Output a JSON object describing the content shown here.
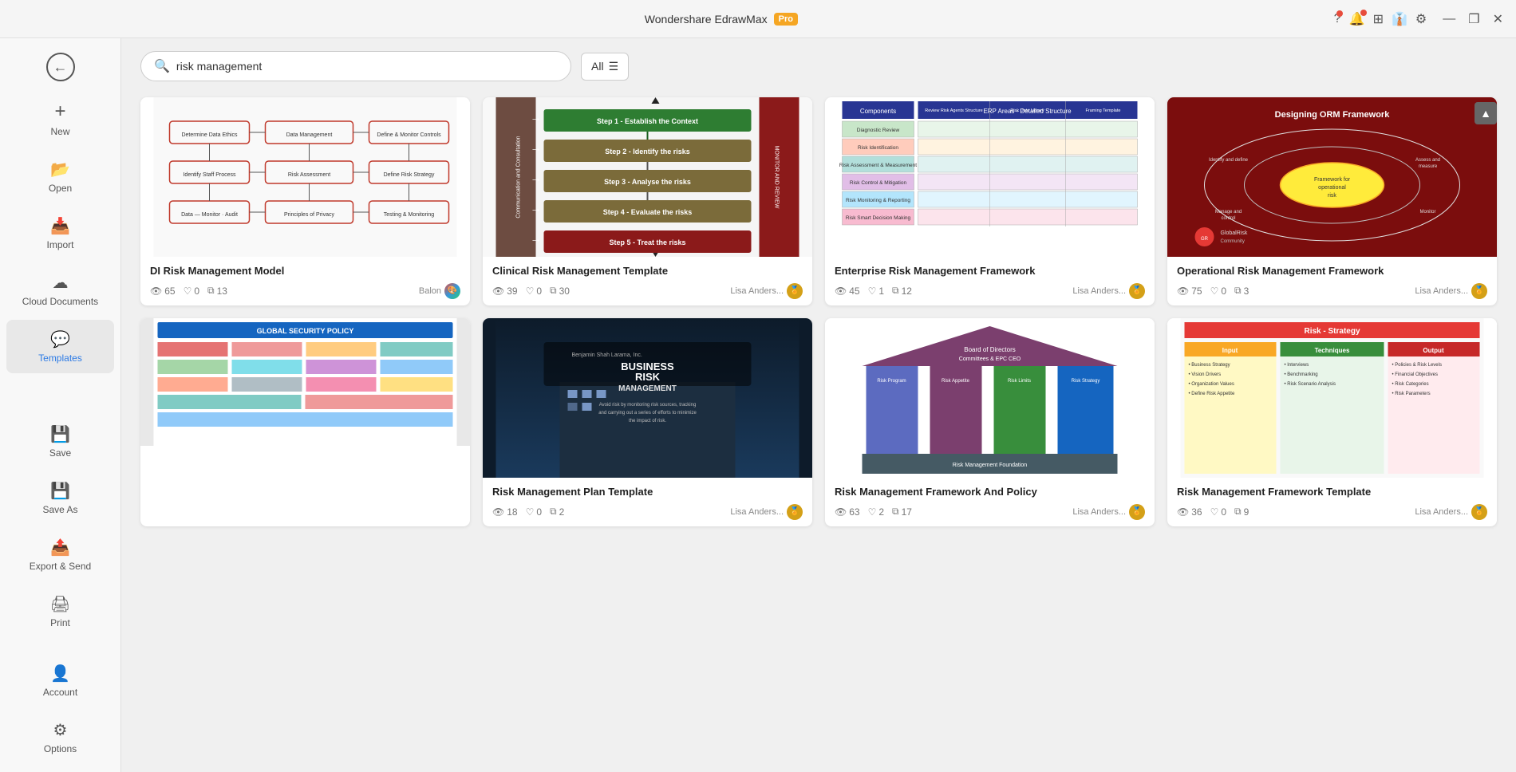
{
  "app": {
    "title": "Wondershare EdrawMax",
    "badge": "Pro"
  },
  "titlebar": {
    "minimize": "—",
    "restore": "❐",
    "close": "✕"
  },
  "toolbar": {
    "icons": [
      "?",
      "🔔",
      "⊞",
      "👔",
      "⚙"
    ]
  },
  "sidebar": {
    "back_label": "←",
    "items": [
      {
        "id": "new",
        "icon": "➕",
        "label": "New"
      },
      {
        "id": "open",
        "icon": "📂",
        "label": "Open"
      },
      {
        "id": "import",
        "icon": "📥",
        "label": "Import"
      },
      {
        "id": "cloud",
        "icon": "☁",
        "label": "Cloud Documents"
      },
      {
        "id": "templates",
        "icon": "💬",
        "label": "Templates",
        "active": true
      },
      {
        "id": "save",
        "icon": "💾",
        "label": "Save"
      },
      {
        "id": "saveas",
        "icon": "💾",
        "label": "Save As"
      },
      {
        "id": "export",
        "icon": "📤",
        "label": "Export & Send"
      },
      {
        "id": "print",
        "icon": "🖨",
        "label": "Print"
      }
    ],
    "bottom": [
      {
        "id": "account",
        "icon": "👤",
        "label": "Account"
      },
      {
        "id": "options",
        "icon": "⚙",
        "label": "Options"
      }
    ]
  },
  "search": {
    "placeholder": "risk management",
    "value": "risk management",
    "filter_label": "All"
  },
  "templates": [
    {
      "id": "di-risk",
      "title": "DI Risk Management Model",
      "views": 65,
      "likes": 0,
      "copies": 13,
      "author": "Balon",
      "author_type": "colorful"
    },
    {
      "id": "clinical-risk",
      "title": "Clinical Risk Management Template",
      "views": 39,
      "likes": 0,
      "copies": 30,
      "author": "Lisa Anders...",
      "author_type": "gold"
    },
    {
      "id": "enterprise-risk",
      "title": "Enterprise Risk Management Framework",
      "views": 45,
      "likes": 1,
      "copies": 12,
      "author": "Lisa Anders...",
      "author_type": "gold"
    },
    {
      "id": "orm-framework",
      "title": "Operational Risk Management Framework",
      "views": 75,
      "likes": 0,
      "copies": 3,
      "author": "Lisa Anders...",
      "author_type": "gold"
    },
    {
      "id": "global-security",
      "title": "Global Security Policy",
      "views": null,
      "likes": null,
      "copies": null,
      "author": "",
      "author_type": ""
    },
    {
      "id": "business-risk",
      "title": "Risk Management Plan Template",
      "views": 18,
      "likes": 0,
      "copies": 2,
      "author": "Lisa Anders...",
      "author_type": "gold"
    },
    {
      "id": "rmfp",
      "title": "Risk Management Framework And Policy",
      "views": 63,
      "likes": 2,
      "copies": 17,
      "author": "Lisa Anders...",
      "author_type": "gold"
    },
    {
      "id": "risk-strategy",
      "title": "Risk Management Framework Template",
      "views": 36,
      "likes": 0,
      "copies": 9,
      "author": "Lisa Anders...",
      "author_type": "gold"
    }
  ]
}
